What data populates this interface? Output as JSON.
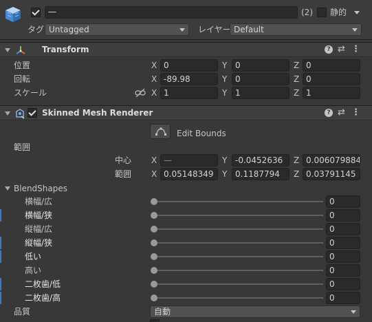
{
  "gameobject": {
    "active": true,
    "name": "一",
    "count_badge": "(2)",
    "static_label": "静的",
    "tag_label": "タグ",
    "tag_value": "Untagged",
    "layer_label": "レイヤー",
    "layer_value": "Default"
  },
  "transform": {
    "title": "Transform",
    "rows": [
      {
        "label": "位置",
        "x": "0",
        "y": "0",
        "z": "0"
      },
      {
        "label": "回転",
        "x": "-89.98",
        "y": "0",
        "z": "0"
      },
      {
        "label": "スケール",
        "x": "1",
        "y": "1",
        "z": "1"
      }
    ]
  },
  "axes": {
    "x": "X",
    "y": "Y",
    "z": "Z"
  },
  "renderer": {
    "title": "Skinned Mesh Renderer",
    "enabled": true,
    "edit_bounds_label": "Edit Bounds",
    "bounds_label": "範囲",
    "center_label": "中心",
    "center": {
      "x": "—",
      "y": "-0.0452636",
      "z": "0.006079884"
    },
    "extent_label": "範囲",
    "extent": {
      "x": "0.05148349",
      "y": "0.1187794",
      "z": "0.03791145"
    },
    "blendshapes_label": "BlendShapes",
    "blendshapes": [
      {
        "label": "横幅/広",
        "value": "0",
        "highlight": false
      },
      {
        "label": "横幅/狭",
        "value": "0",
        "highlight": true
      },
      {
        "label": "縦幅/広",
        "value": "0",
        "highlight": false
      },
      {
        "label": "縦幅/狭",
        "value": "0",
        "highlight": true
      },
      {
        "label": "低い",
        "value": "0",
        "highlight": true
      },
      {
        "label": "高い",
        "value": "0",
        "highlight": false
      },
      {
        "label": "二枚歯/低",
        "value": "0",
        "highlight": true
      },
      {
        "label": "二枚歯/高",
        "value": "0",
        "highlight": true
      }
    ],
    "quality_label": "品質",
    "quality_value": "自動"
  },
  "colors": {
    "background": "#383838",
    "field": "#2a2a2a",
    "highlight": "#3d79c7"
  }
}
